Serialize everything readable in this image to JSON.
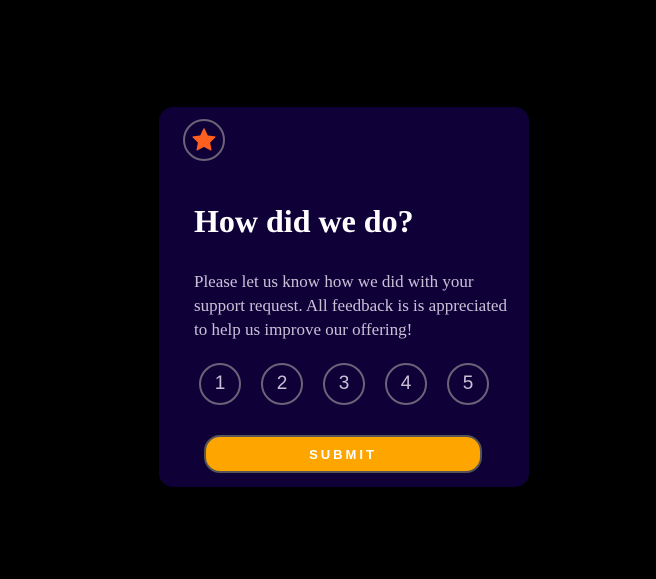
{
  "card": {
    "icon": "star-icon",
    "title": "How did we do?",
    "description": "Please let us know how we did with your support request. All feedback is is appreciated to help us improve our offering!",
    "ratings": [
      "1",
      "2",
      "3",
      "4",
      "5"
    ],
    "submit_label": "SUBMIT"
  },
  "colors": {
    "background": "#000000",
    "card": "#0f0038",
    "accent_star": "#ff5f1f",
    "submit": "#ffa500",
    "text_primary": "#ffffff",
    "text_secondary": "#c9c0d6"
  }
}
